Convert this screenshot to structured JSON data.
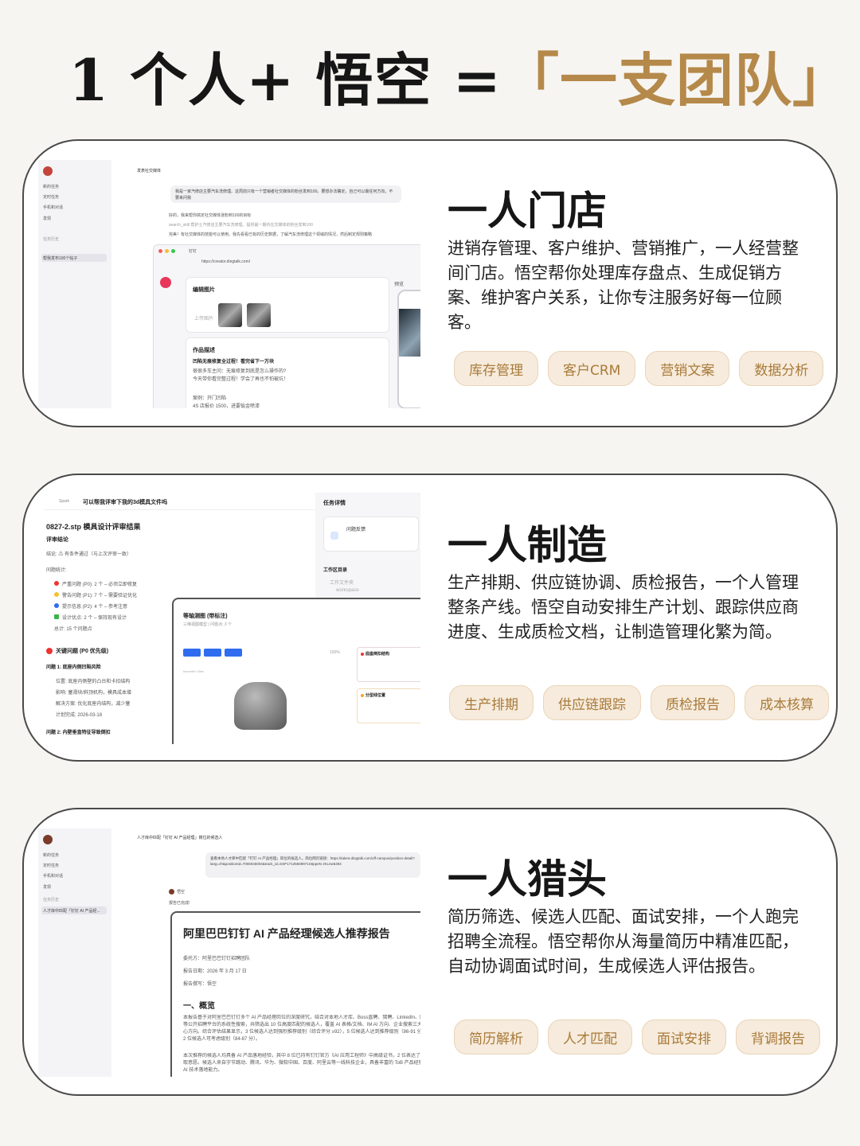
{
  "headline": {
    "part1": "1 个人+ 悟空 = ",
    "part2": "「一支团队」"
  },
  "cards": [
    {
      "title": "一人门店",
      "desc": "进销存管理、客户维护、营销推广，一人经营整间门店。悟空帮你处理库存盘点、生成促销方案、维护客户关系，让你专注服务好每一位顾客。",
      "tags": [
        "库存管理",
        "客户CRM",
        "营销文案",
        "数据分析"
      ]
    },
    {
      "title": "一人制造",
      "desc": "生产排期、供应链协调、质检报告，一个人管理整条产线。悟空自动安排生产计划、跟踪供应商进度、生成质检文档，让制造管理化繁为简。",
      "tags": [
        "生产排期",
        "供应链跟踪",
        "质检报告",
        "成本核算"
      ]
    },
    {
      "title": "一人猎头",
      "desc": "简历筛选、候选人匹配、面试安排，一个人跑完招聘全流程。悟空帮你从海量简历中精准匹配，自动协调面试时间，生成候选人评估报告。",
      "tags": [
        "简历解析",
        "人才匹配",
        "面试安排",
        "背调报告"
      ]
    }
  ],
  "mock1": {
    "header": "发表社交媒体",
    "sidebar": [
      "新的任务",
      "定时任务",
      "手机和对话",
      "发现"
    ],
    "history_label": "任务历史",
    "selected": "帮我发布100个帖子",
    "bubble": "我是一家汽修店主要汽车洗修理。这周前只有一个营销者社交媒体的粉丝发到100。要想办法确定，自己可以做任何方向，不要来问我",
    "line1": "好的，我来帮你搞定社交媒体涨粉到100的目标",
    "line2": "search_skill 帮护士汽修店主要汽车洗修理。提供最一期内在交媒体的粉丝发到100",
    "line3": "完美！有社交媒体的技能可以使用。我先看看已有的历史数据，了解汽车洗修理这个领域的情况，然后制定规则策略",
    "url": "https://creator.dingtalk.com/",
    "tab": "钉钉",
    "edit_images": "编辑图片",
    "upload": "上传图片",
    "work_desc": "作品描述",
    "post_title": "凹陷无痕修复全过程！看完省下一万块",
    "post_body1": "很很多车主问：无痕修复到底是怎么操作的?",
    "post_body2": "今天带你看完整过程！学会了再也不怕被坑！",
    "post_addr": "案例：开门凹陷",
    "post_price": "4S 店报价 1500，进要钣金喷漆",
    "preview": "预览"
  },
  "mock2": {
    "topbar": "可以帮我评审下我的3d模具文件吗",
    "agent": "Spark",
    "file_title": "0827-2.stp 模具设计评审结果",
    "conclusion_h": "评审结论",
    "conclusion": "结论: ⚠ 有条件通过（与上次评审一致）",
    "stats_h": "问题统计:",
    "stats": [
      "严重问题 (P0): 2 个 – 必须立即修复",
      "警告问题 (P1): 7 个 – 需要验证优化",
      "提示信息 (P2): 4 个 – 参考注意",
      "设计优点: 2 个 – 保持现有设计",
      "总计: 15 个问题点"
    ],
    "key_h": "关键问题 (P0 优先级)",
    "issue1": "问题 1: 底座内侧凹陷风险",
    "issue1_lines": [
      "位置: 底座内侧壁的凸台和卡扣结构",
      "影响: 塞滑块/斜顶机构，模具成本增",
      "解决方案: 优化底座内结构，减少塞",
      "计划完成: 2026-03-18"
    ],
    "issue2": "问题 2: 内壁垂直特征导致倒扣",
    "task_h": "任务详情",
    "issue_fb": "问题反馈",
    "workspace": "工作区目录",
    "workspace_item": "工作文件夹",
    "workspace_sub": "workspace",
    "view_title": "等轴测图 (带标注)",
    "view_sub": "三维视图模型 | 问题点: 3 个",
    "zoom": "100%",
    "iso": "Isometric View",
    "red1": "底座倒扣结构",
    "red2": "分型线位置"
  },
  "mock3": {
    "header": "人才库中匹配「钉钉 AI 产品经理」岗位的候选人",
    "sidebar": [
      "新的任务",
      "定时任务",
      "手机和对话",
      "发现"
    ],
    "history_label": "任务历史",
    "selected": "人才库中匹配「钉钉 AI 产品经...",
    "bubble": "查看本地人才库中匹配「钉钉 AI 产品经理」岗位的候选人。岗位网页链接：https://talent.dingtalk.com/off-campus/position-detail?lang=zh&positionId=7006045004&track_id=SSP17135508971S6ppeN zKLnw6484",
    "agent": "悟空",
    "done": "报告已完成!",
    "report_title": "阿里巴巴钉钉 AI 产品经理候选人推荐报告",
    "meta1": "委托方：阿里巴巴钉钉招聘团队",
    "meta2": "报告日期：2026 年 3 月 17 日",
    "meta3": "报告撰写：悟空",
    "sec1": "一、概览",
    "para1": "本报告基于对阿里巴巴钉钉多个 AI 产品经理岗位的深度研究，结合对本地人才库、Boss直聘、猎聘、LinkedIn、脉脉等公开招聘平台的系统性搜索，共筛选出 10 位高度匹配的候选人，覆盖 AI 表格/文档、IM AI 方向、企业搜索三大核心方向。综合评估结果显示，3 位候选人达到强烈推荐级别（综合评分 ≥92），5 位候选人达到推荐级别（86-91 分），2 位候选人可考虑级别（84-87 分）。",
    "para2": "本次推荐的候选人均具备 AI 产品落地经验，其中 8 位已持有钉钉官方《AI 应用工程师》中高级证书，2 位表达了考取意愿。候选人来自字节跳动、腾讯、华为、微软中国、百度、阿里云等一线科技企业，具备丰富的 ToB 产品经验和 AI 技术落地能力。"
  }
}
